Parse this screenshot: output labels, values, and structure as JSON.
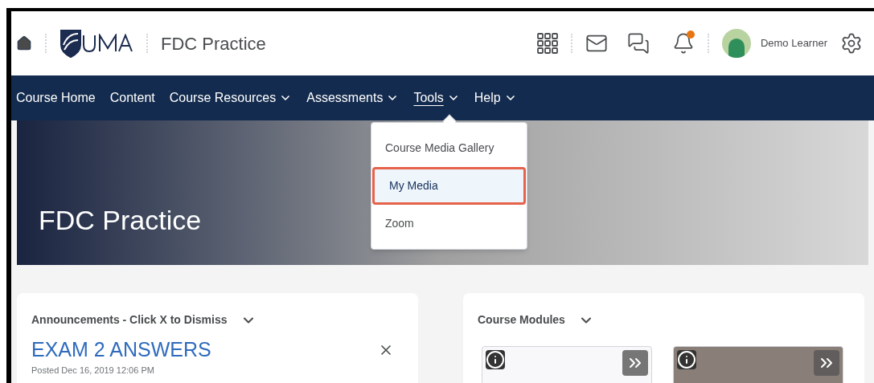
{
  "header": {
    "course_title": "FDC Practice",
    "user_name": "Demo Learner",
    "notification_unread": true
  },
  "nav": [
    {
      "label": "Course Home",
      "dropdown": false,
      "active": false
    },
    {
      "label": "Content",
      "dropdown": false,
      "active": false
    },
    {
      "label": "Course Resources",
      "dropdown": true,
      "active": false
    },
    {
      "label": "Assessments",
      "dropdown": true,
      "active": false
    },
    {
      "label": "Tools",
      "dropdown": true,
      "active": true
    },
    {
      "label": "Help",
      "dropdown": true,
      "active": false
    }
  ],
  "tools_menu": [
    {
      "label": "Course Media Gallery",
      "selected": false
    },
    {
      "label": "My Media",
      "selected": true
    },
    {
      "label": "Zoom",
      "selected": false
    }
  ],
  "banner": {
    "title": "FDC Practice"
  },
  "announcements": {
    "title": "Announcements - Click X to Dismiss",
    "item_title": "EXAM 2 ANSWERS",
    "posted": "Posted Dec 16, 2019 12:06 PM"
  },
  "modules": {
    "title": "Course Modules",
    "tiles": [
      {
        "kind": "logo"
      },
      {
        "kind": "photo"
      }
    ]
  }
}
